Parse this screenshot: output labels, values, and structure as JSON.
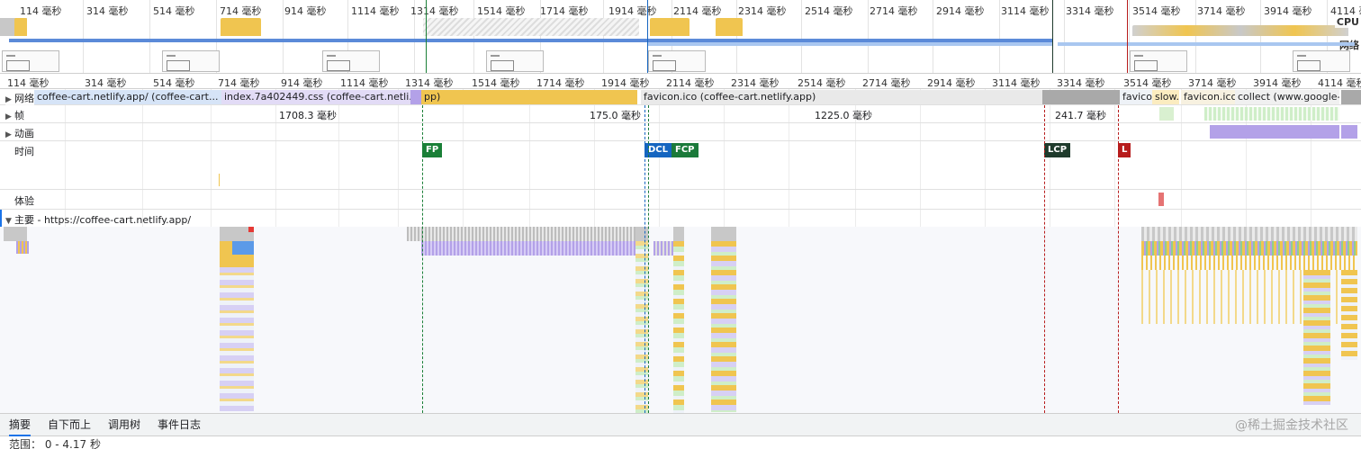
{
  "overview": {
    "ticks": [
      "114 毫秒",
      "314 毫秒",
      "514 毫秒",
      "714 毫秒",
      "914 毫秒",
      "1114 毫秒",
      "1314 毫秒",
      "1514 毫秒",
      "1714 毫秒",
      "1914 毫秒",
      "2114 毫秒",
      "2314 毫秒",
      "2514 毫秒",
      "2714 毫秒",
      "2914 毫秒",
      "3114 毫秒",
      "3314 毫秒",
      "3514 毫秒",
      "3714 毫秒",
      "3914 毫秒",
      "4114 毫秒"
    ],
    "cpu_label": "CPU",
    "net_label": "网络"
  },
  "ruler": {
    "ticks": [
      "114 毫秒",
      "314 毫秒",
      "514 毫秒",
      "714 毫秒",
      "914 毫秒",
      "1114 毫秒",
      "1314 毫秒",
      "1514 毫秒",
      "1714 毫秒",
      "1914 毫秒",
      "2114 毫秒",
      "2314 毫秒",
      "2514 毫秒",
      "2714 毫秒",
      "2914 毫秒",
      "3114 毫秒",
      "3314 毫秒",
      "3514 毫秒",
      "3714 毫秒",
      "3914 毫秒",
      "4114 毫秒"
    ]
  },
  "tracks": {
    "network": {
      "label": "网络",
      "items": [
        "coffee-cart.netlify.app/ (coffee-cart...",
        "index.7a402449.css (coffee-cart.netli...",
        "pp)",
        "favicon.ico (coffee-cart.netlify.app)",
        "favico",
        "slow.",
        "favicon.icc",
        "collect (www.google-"
      ]
    },
    "frames": {
      "label": "帧",
      "values": [
        "1708.3 毫秒",
        "175.0 毫秒",
        "1225.0 毫秒",
        "241.7 毫秒"
      ]
    },
    "animation": {
      "label": "动画"
    },
    "timings": {
      "label": "时间",
      "markers": [
        "FP",
        "DCL",
        "FCP",
        "LCP",
        "L"
      ]
    },
    "experience": {
      "label": "体验"
    },
    "main": {
      "label": "主要 - https://coffee-cart.netlify.app/"
    }
  },
  "tabs": [
    "摘要",
    "自下而上",
    "调用树",
    "事件日志"
  ],
  "range": "范围： 0 - 4.17 秒",
  "watermark": "@稀土掘金技术社区",
  "colors": {
    "scripting": "#f0c550",
    "rendering": "#b3a1e8",
    "painting": "#8fcf8f",
    "idle": "#c8c8c8",
    "fp": "#1a7f37",
    "dcl": "#1565c0",
    "fcp": "#1b7a3a",
    "lcp": "#1f3b2c",
    "load": "#b71c1c"
  }
}
